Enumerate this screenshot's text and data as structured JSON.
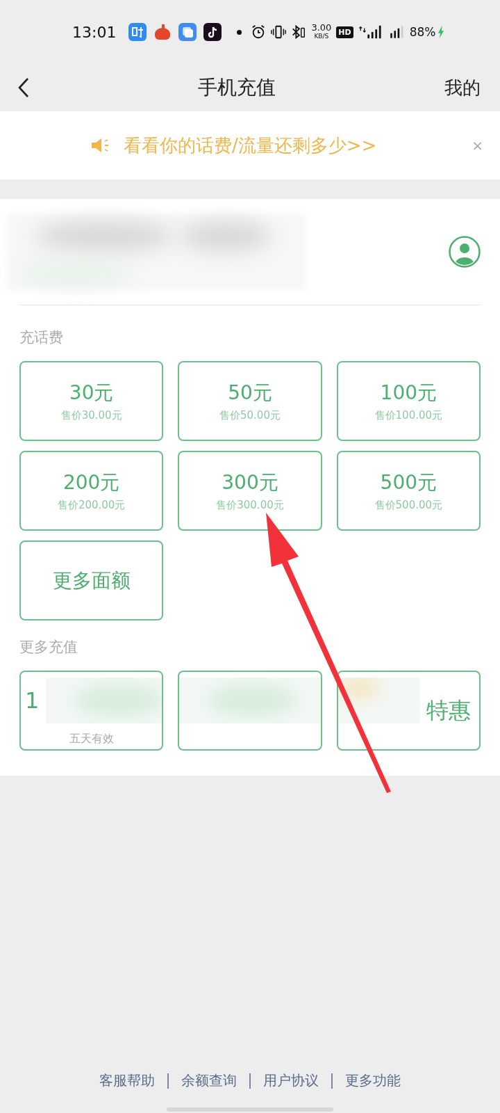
{
  "status_bar": {
    "time": "13:01",
    "speed_value": "3.00",
    "speed_unit": "KB/S",
    "hd": "HD",
    "battery": "88%"
  },
  "nav": {
    "title": "手机充值",
    "right": "我的"
  },
  "notice": {
    "text": "看看你的话费/流量还剩多少>>",
    "close": "×"
  },
  "recharge": {
    "title": "充话费",
    "options": [
      {
        "amount": "30元",
        "price": "售价30.00元"
      },
      {
        "amount": "50元",
        "price": "售价50.00元"
      },
      {
        "amount": "100元",
        "price": "售价100.00元"
      },
      {
        "amount": "200元",
        "price": "售价200.00元"
      },
      {
        "amount": "300元",
        "price": "售价300.00元"
      },
      {
        "amount": "500元",
        "price": "售价500.00元"
      }
    ],
    "more": "更多面额"
  },
  "more_section": {
    "title": "更多充值",
    "cards": [
      {
        "kind": "left",
        "title": "1",
        "subtitle": "五天有效"
      },
      {
        "kind": "covered"
      },
      {
        "kind": "right",
        "title": "特惠"
      }
    ]
  },
  "footer": [
    "客服帮助",
    "余额查询",
    "用户协议",
    "更多功能"
  ]
}
